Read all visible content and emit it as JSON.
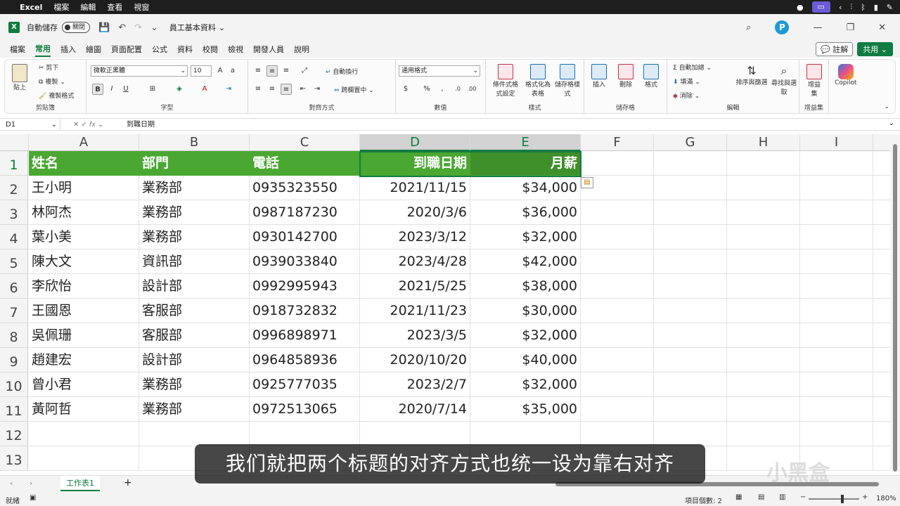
{
  "mac_menu": {
    "app": "Excel",
    "items": [
      "檔案",
      "編輯",
      "查看",
      "視窗"
    ]
  },
  "titlebar": {
    "autosave_label": "自動儲存",
    "toggle_label": "關閉",
    "doc_title": "員工基本資料",
    "avatar": "P"
  },
  "tabs": [
    "檔案",
    "常用",
    "插入",
    "繪圖",
    "頁面配置",
    "公式",
    "資料",
    "校閱",
    "檢視",
    "開發人員",
    "說明"
  ],
  "active_tab": "常用",
  "comment_label": "註解",
  "share_label": "共用",
  "ribbon": {
    "clipboard": {
      "label": "剪貼簿",
      "paste": "貼上",
      "cut": "剪下",
      "copy": "複製",
      "format_painter": "複製格式"
    },
    "font": {
      "label": "字型",
      "name": "微軟正黑體",
      "size": "10"
    },
    "alignment": {
      "label": "對齊方式",
      "wrap": "自動換行",
      "merge": "跨欄置中"
    },
    "number": {
      "label": "數值",
      "format": "通用格式"
    },
    "styles": {
      "label": "樣式",
      "conditional": "條件式格式設定",
      "table": "格式化為表格",
      "cell": "儲存格樣式"
    },
    "cells": {
      "label": "儲存格",
      "insert": "插入",
      "delete": "刪除",
      "format": "格式"
    },
    "editing": {
      "label": "編輯",
      "autosum": "自動加總",
      "fill": "填滿",
      "clear": "消除",
      "sort": "排序與篩選",
      "find": "尋找與選取"
    },
    "addins": {
      "label": "增益集",
      "addins": "增益集"
    },
    "copilot": "Copilot"
  },
  "formula_bar": {
    "name_box": "D1",
    "content": "到職日期"
  },
  "columns": [
    "A",
    "B",
    "C",
    "D",
    "E",
    "F",
    "G",
    "H",
    "I"
  ],
  "rows": [
    "1",
    "2",
    "3",
    "4",
    "5",
    "6",
    "7",
    "8",
    "9",
    "10",
    "11",
    "12",
    "13"
  ],
  "table": {
    "headers": [
      "姓名",
      "部門",
      "電話",
      "到職日期",
      "月薪"
    ],
    "data": [
      [
        "王小明",
        "業務部",
        "0935323550",
        "2021/11/15",
        "$34,000"
      ],
      [
        "林阿杰",
        "業務部",
        "0987187230",
        "2020/3/6",
        "$36,000"
      ],
      [
        "葉小美",
        "業務部",
        "0930142700",
        "2023/3/12",
        "$32,000"
      ],
      [
        "陳大文",
        "資訊部",
        "0939033840",
        "2023/4/28",
        "$42,000"
      ],
      [
        "李欣怡",
        "設計部",
        "0992995943",
        "2021/5/25",
        "$38,000"
      ],
      [
        "王國恩",
        "客服部",
        "0918732832",
        "2021/11/23",
        "$30,000"
      ],
      [
        "吳佩珊",
        "客服部",
        "0996898971",
        "2023/3/5",
        "$32,000"
      ],
      [
        "趙建宏",
        "設計部",
        "0964858936",
        "2020/10/20",
        "$40,000"
      ],
      [
        "曾小君",
        "業務部",
        "0925777035",
        "2023/2/7",
        "$32,000"
      ],
      [
        "黃阿哲",
        "業務部",
        "0972513065",
        "2020/7/14",
        "$35,000"
      ]
    ]
  },
  "sheet_tab": "工作表1",
  "status": {
    "ready": "就緒",
    "count": "項目個數: 2",
    "zoom": "180%"
  },
  "subtitle": "我们就把两个标题的对齐方式也统一设为靠右对齐",
  "watermark": "小黑盒"
}
